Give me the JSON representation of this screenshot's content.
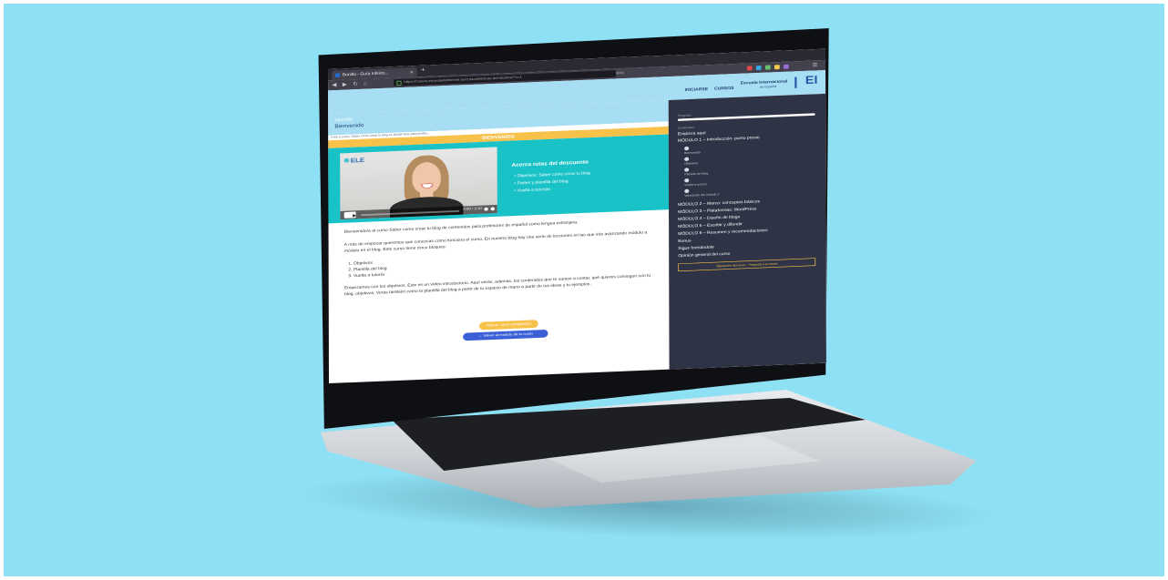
{
  "browser": {
    "tab_title": "Bonilla - Guía Infinito...",
    "tab_close": "✕",
    "new_tab": "+",
    "url": "https://cursos.escueladeinternet.es/cursos/ele/ruta-del-alumno/?c=1",
    "zoom": "80%",
    "extensions": [
      "#e04a4a",
      "#3aa3e0",
      "#6bc16b",
      "#f2c94c",
      "#9b6bd6"
    ]
  },
  "site": {
    "brand": "EI",
    "school_name": "Escuela Internacional",
    "school_sub": "de Español",
    "nav": [
      "INICIARSE",
      "CURSOS"
    ]
  },
  "course": {
    "section_title": "Lección",
    "lesson_name": "Bienvenido",
    "breadcrumb": "Ruta a curso: Saber cómo crear tu blog en WordPress para profes...",
    "banner": "BIENVENIDO",
    "video_logo": "ELE",
    "video_time": "0:00 / 2:10",
    "intro_title": "Acerca rutas del descuento",
    "intro_items": [
      "Objetivos: Saber cómo crear tu blog",
      "Partes y plantilla del blog",
      "Vuelta a tutorías"
    ]
  },
  "content": {
    "p1": "Bienvenido/a al curso Saber cómo crear tu blog de contenidos para profesores de español como lengua extranjera.",
    "p2": "A más de empezar queremos que conozcas cómo funciona el curso. En nuestro blog hay una serie de lecciones en las que irás avanzando módulo a módulo en el blog. Este curso tiene cinco bloques:",
    "list": [
      "Objetivos",
      "Plantilla del blog",
      "Vuelta a tutoría"
    ],
    "p3": "Empezamos con los objetivos. Este es un vídeo introductorio. Aquí verás, además, los contenidos que te vamos a contar, qué quieres conseguir con tu blog, objetivos. Verás también cómo la plantilla del blog a partir de tu espacio de mano a partir de tus ideas y tu ejemplos.",
    "btn_next": "Marcar como completada",
    "btn_back": "← Volver al módulo de tu curso"
  },
  "sidebar": {
    "progress_label": "Progreso",
    "progress": 1.0,
    "contents_label": "Contenidos",
    "items": [
      "Empieza aquí",
      "MÓDULO 1 – Introducción: punto previo",
      "MÓDULO 2 – Marco: conceptos básicos",
      "MÓDULO 3 – Plataformas: WordPress",
      "MÓDULO 4 – Diseño de blogs",
      "MÓDULO 5 – Escribir y difundir",
      "MÓDULO 6 – Resumen y recomendaciones",
      "Bonus",
      "Sigue formándote",
      "Opinión general del curso"
    ],
    "sub_items": [
      "Bienvenido",
      "Objetivos",
      "Plantilla del blog",
      "Vuelta a tutoría",
      "Valoración del módulo 1"
    ],
    "footer_link": "Valoración del curso ‑ Pregunta a tu tutora"
  }
}
